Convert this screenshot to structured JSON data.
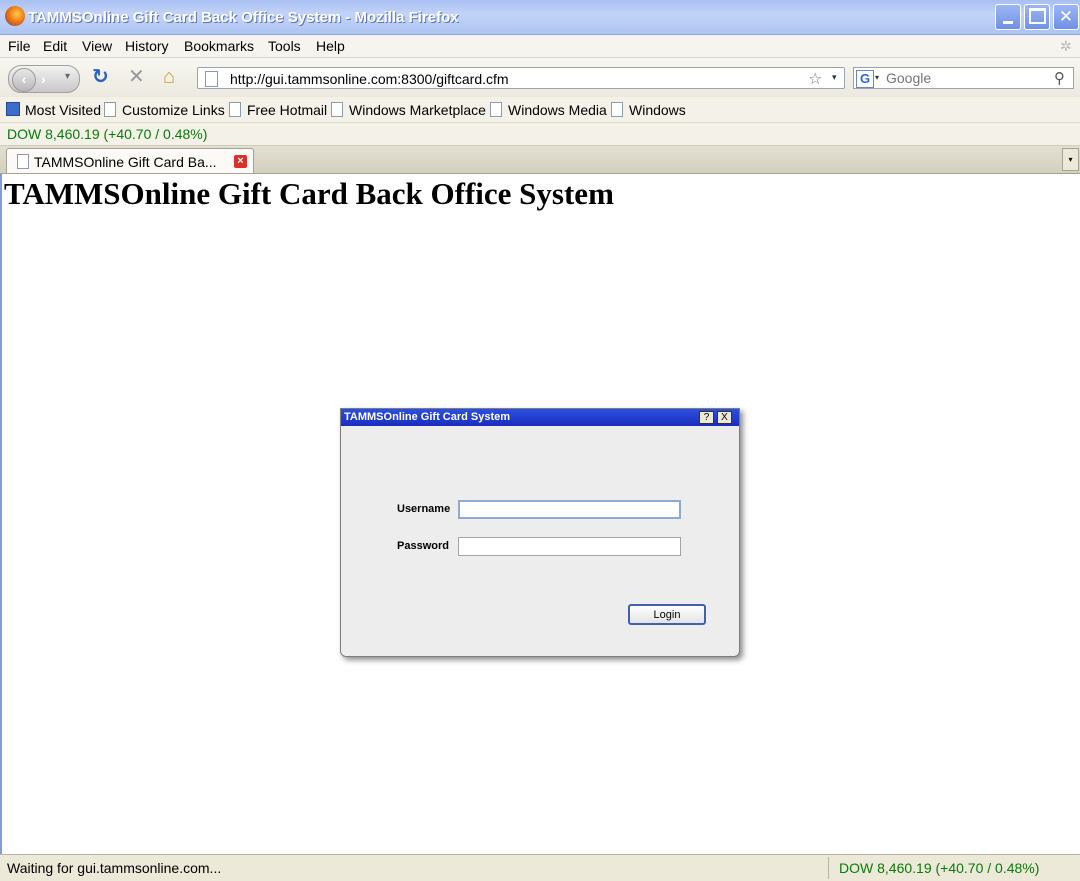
{
  "window": {
    "title": "TAMMSOnline Gift Card Back Office System - Mozilla Firefox",
    "minimize_glyph": "_",
    "maximize_glyph": "□",
    "close_glyph": "✕"
  },
  "menu": {
    "items": [
      {
        "label": "File"
      },
      {
        "label": "Edit"
      },
      {
        "label": "View"
      },
      {
        "label": "History"
      },
      {
        "label": "Bookmarks"
      },
      {
        "label": "Tools"
      },
      {
        "label": "Help"
      }
    ]
  },
  "navigation": {
    "url": "http://gui.tammsonline.com:8300/giftcard.cfm",
    "search_placeholder": "Google",
    "search_engine_glyph": "G"
  },
  "bookmarks": {
    "items": [
      {
        "label": "Most Visited"
      },
      {
        "label": "Customize Links"
      },
      {
        "label": "Free Hotmail"
      },
      {
        "label": "Windows Marketplace"
      },
      {
        "label": "Windows Media"
      },
      {
        "label": "Windows"
      }
    ]
  },
  "ticker": {
    "text": "DOW 8,460.19 (+40.70 / 0.48%)"
  },
  "tabs": [
    {
      "label": "TAMMSOnline Gift Card Ba...",
      "active": true
    }
  ],
  "page": {
    "heading": "TAMMSOnline Gift Card Back Office System"
  },
  "dialog": {
    "title": "TAMMSOnline Gift Card System",
    "help_glyph": "?",
    "close_glyph": "X",
    "username_label": "Username",
    "username_value": "",
    "password_label": "Password",
    "password_value": "",
    "login_label": "Login"
  },
  "status": {
    "left_text": "Waiting for gui.tammsonline.com...",
    "right_text": "DOW 8,460.19 (+40.70 / 0.48%)"
  },
  "colors": {
    "titlebar": "#aec5f2",
    "dialog_titlebar": "#1a2dbd",
    "ticker_text": "#0a7a0a"
  }
}
